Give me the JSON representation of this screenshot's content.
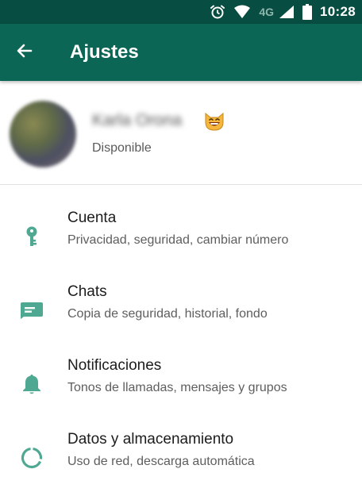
{
  "status_bar": {
    "network_label": "4G",
    "time": "10:28",
    "icons": [
      "alarm-icon",
      "wifi-icon",
      "signal-icon",
      "battery-icon"
    ]
  },
  "app_bar": {
    "back_icon": "arrow-back-icon",
    "title": "Ajustes"
  },
  "profile": {
    "name": "Karla Orona",
    "emoji": "cat-face-icon",
    "status": "Disponible"
  },
  "settings": [
    {
      "icon": "key-icon",
      "title": "Cuenta",
      "subtitle": "Privacidad, seguridad, cambiar número"
    },
    {
      "icon": "chat-icon",
      "title": "Chats",
      "subtitle": "Copia de seguridad, historial, fondo"
    },
    {
      "icon": "bell-icon",
      "title": "Notificaciones",
      "subtitle": "Tonos de llamadas, mensajes y grupos"
    },
    {
      "icon": "data-usage-icon",
      "title": "Datos y almacenamiento",
      "subtitle": "Uso de red, descarga automática"
    }
  ],
  "colors": {
    "status_bar": "#084d41",
    "app_bar": "#0b6655",
    "icon_accent": "#4fa892",
    "title_text": "#ffffff"
  }
}
